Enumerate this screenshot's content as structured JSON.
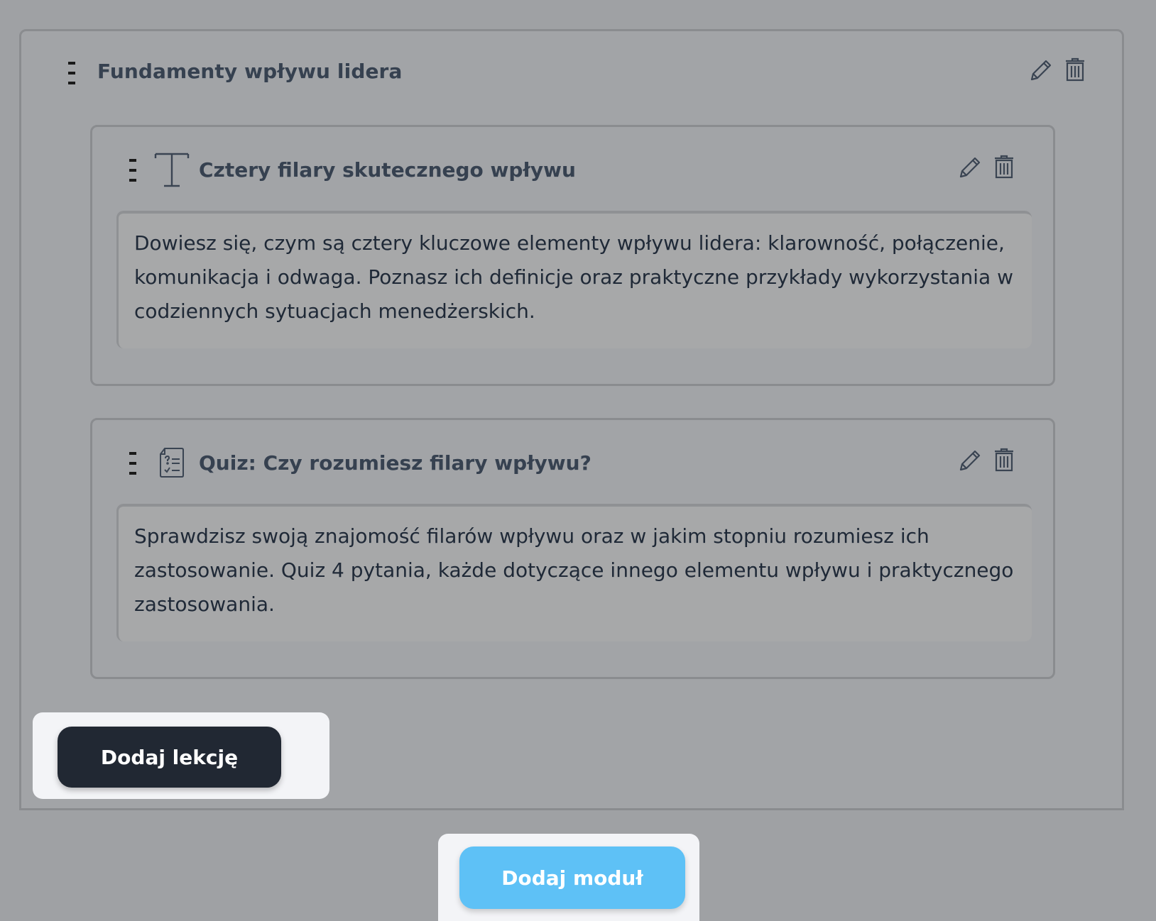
{
  "module": {
    "title": "Fundamenty wpływu lidera",
    "icons": {
      "drag": "drag-handle-icon",
      "edit": "pencil-icon",
      "delete": "trash-icon"
    }
  },
  "lessons": [
    {
      "type_icon": "text-type-icon",
      "title": "Cztery filary skutecznego wpływu",
      "description": "Dowiesz się, czym są cztery kluczowe elementy wpływu lidera: klarowność, połączenie, komunikacja i odwaga. Poznasz ich definicje oraz praktyczne przykłady wykorzystania w codziennych sytuacjach menedżerskich."
    },
    {
      "type_icon": "quiz-type-icon",
      "title": "Quiz: Czy rozumiesz filary wpływu?",
      "description": "Sprawdzisz swoją znajomość filarów wpływu oraz w jakim stopniu rozumiesz ich zastosowanie. Quiz 4 pytania, każde dotyczące innego elementu wpływu i praktycznego zastosowania."
    }
  ],
  "actions": {
    "add_lesson": "Dodaj lekcję",
    "add_module": "Dodaj moduł"
  },
  "colors": {
    "overlay_bg": "#9fa1a4",
    "title_text": "#364150",
    "add_lesson_bg": "#212833",
    "add_module_bg": "#5ec1f6",
    "highlight_bg": "#f3f4f7"
  }
}
